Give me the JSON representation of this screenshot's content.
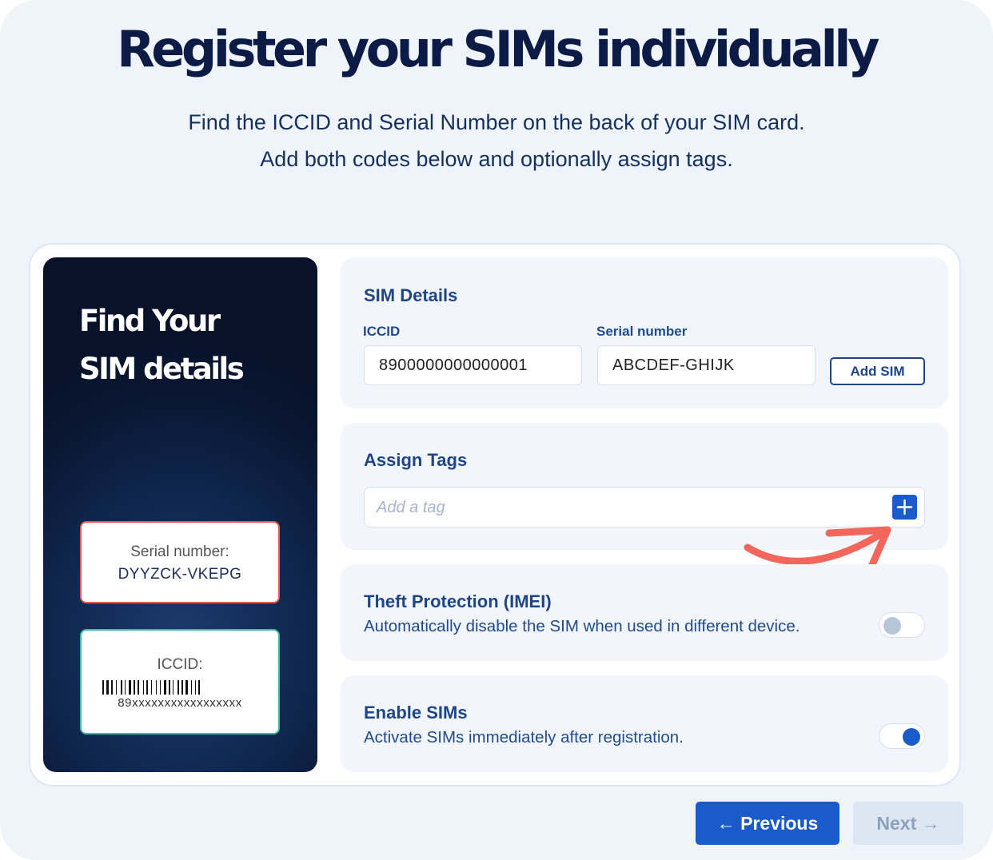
{
  "page": {
    "title": "Register your SIMs individually",
    "subtitle_lines": [
      "Find the ICCID and Serial Number on the back of your SIM card.",
      "Add both codes below and optionally assign tags."
    ]
  },
  "illustration": {
    "heading_lines": [
      "Find Your",
      "SIM details"
    ],
    "serial_label": "Serial number:",
    "serial_value": "DYYZCK-VKEPG",
    "iccid_label": "ICCID:",
    "iccid_value": "89xxxxxxxxxxxxxxxxx"
  },
  "sim_details": {
    "title": "SIM Details",
    "iccid_label": "ICCID",
    "iccid_value": "8900000000000001",
    "serial_label": "Serial number",
    "serial_value": "ABCDEF-GHIJK",
    "add_button": "Add SIM"
  },
  "tags": {
    "title": "Assign Tags",
    "placeholder": "Add a tag",
    "add_icon": "plus-icon"
  },
  "theft_protection": {
    "title": "Theft Protection (IMEI)",
    "description": "Automatically disable the SIM when used in different device.",
    "enabled": false
  },
  "enable_sims": {
    "title": "Enable SIMs",
    "description": "Activate SIMs immediately after registration.",
    "enabled": true
  },
  "nav": {
    "previous": "← Previous",
    "next": "Next →"
  },
  "colors": {
    "accent": "#1a5ac9",
    "highlight_arrow": "#f2665c",
    "serial_border": "#e85a55",
    "iccid_border": "#3bbba5"
  }
}
